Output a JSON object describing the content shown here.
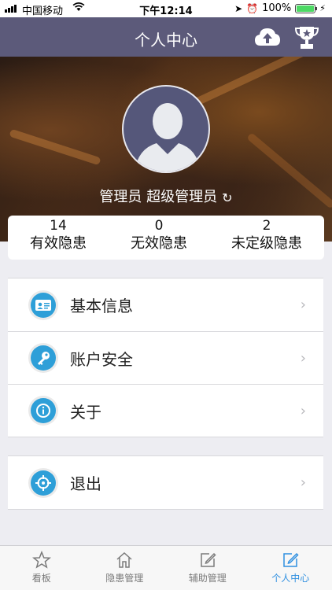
{
  "status_bar": {
    "carrier": "中国移动",
    "time": "下午12:14",
    "battery": "100%"
  },
  "nav": {
    "title": "个人中心"
  },
  "profile": {
    "user_text": "管理员 超级管理员"
  },
  "stats": [
    {
      "value": "14",
      "label": "有效隐患"
    },
    {
      "value": "0",
      "label": "无效隐患"
    },
    {
      "value": "2",
      "label": "未定级隐患"
    }
  ],
  "menu": {
    "items": [
      {
        "label": "基本信息",
        "icon": "id-card-icon"
      },
      {
        "label": "账户安全",
        "icon": "key-icon"
      },
      {
        "label": "关于",
        "icon": "info-icon"
      }
    ],
    "logout": {
      "label": "退出",
      "icon": "crosshair-icon"
    }
  },
  "tabs": [
    {
      "label": "看板",
      "icon": "star-icon"
    },
    {
      "label": "隐患管理",
      "icon": "home-icon"
    },
    {
      "label": "辅助管理",
      "icon": "edit-icon"
    },
    {
      "label": "个人中心",
      "icon": "edit-icon",
      "active": true
    }
  ],
  "colors": {
    "nav": "#5c5a7a",
    "accent": "#2e8fe0",
    "menu_icon": "#2e9fd8"
  }
}
